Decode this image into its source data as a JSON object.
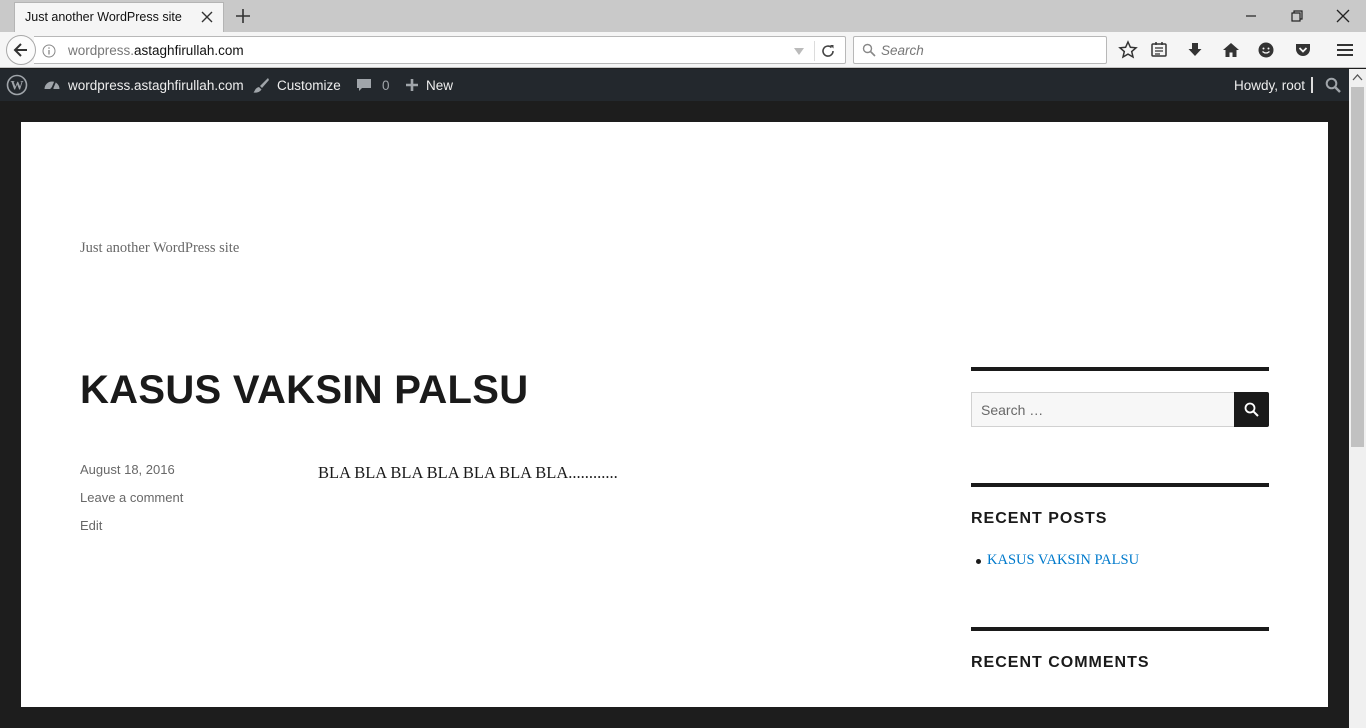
{
  "browser": {
    "tab_title": "Just another WordPress site",
    "url_prefix": "wordpress.",
    "url_host": "astaghfirullah.com",
    "search_placeholder": "Search"
  },
  "admin_bar": {
    "site_name": "wordpress.astaghfirullah.com",
    "customize": "Customize",
    "comments_count": "0",
    "new": "New",
    "howdy": "Howdy, root"
  },
  "site": {
    "tagline": "Just another WordPress site"
  },
  "post": {
    "title": "KASUS VAKSIN PALSU",
    "date": "August 18, 2016",
    "comment_link": "Leave a comment",
    "edit_link": "Edit",
    "body": "BLA BLA BLA BLA BLA BLA BLA............"
  },
  "sidebar": {
    "search_placeholder": "Search …",
    "recent_posts_title": "RECENT POSTS",
    "recent_posts": [
      "KASUS VAKSIN PALSU"
    ],
    "recent_comments_title": "RECENT COMMENTS"
  },
  "colors": {
    "admin_bar": "#23282d",
    "link": "#007acc",
    "text": "#1a1a1a"
  }
}
